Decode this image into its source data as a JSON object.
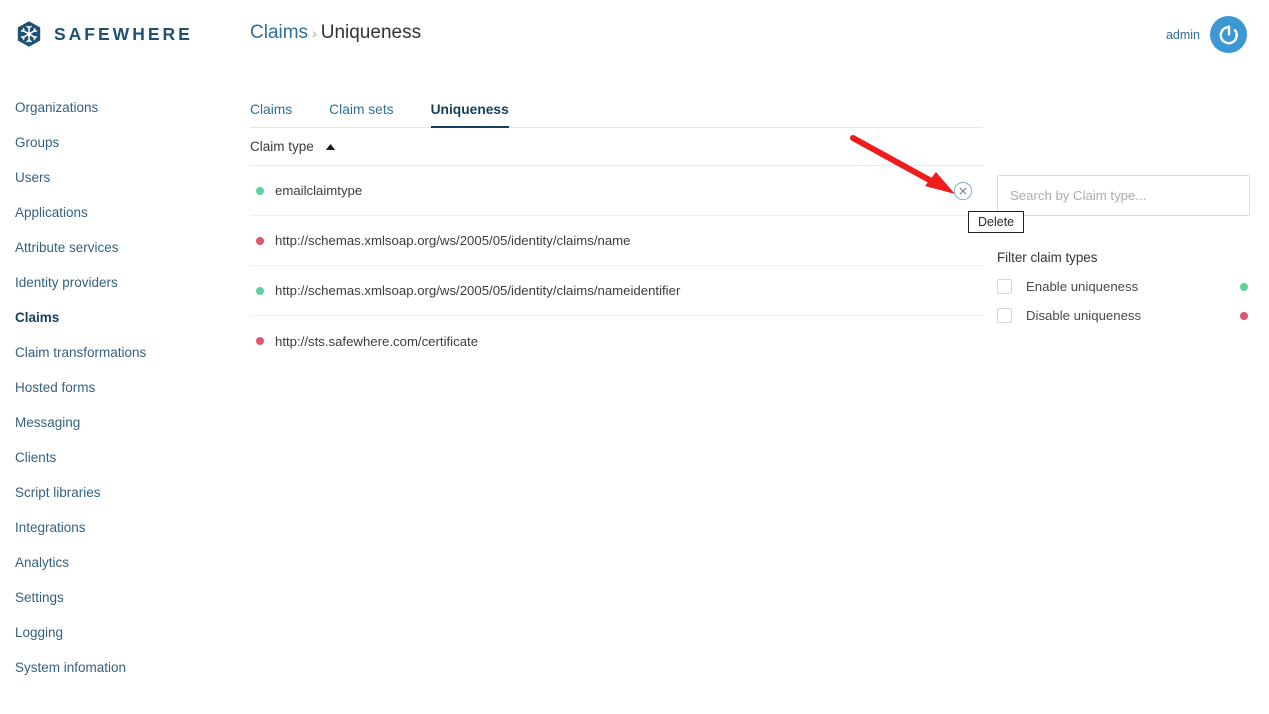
{
  "brand": {
    "name": "SAFEWHERE",
    "logo_icon": "hexagon-snowflake-logo"
  },
  "header": {
    "breadcrumb": {
      "parent": "Claims",
      "separator": "›",
      "current": "Uniqueness"
    },
    "user": {
      "name": "admin",
      "avatar_icon": "power-avatar-icon"
    }
  },
  "sidebar": {
    "items": [
      {
        "label": "Organizations",
        "active": false
      },
      {
        "label": "Groups",
        "active": false
      },
      {
        "label": "Users",
        "active": false
      },
      {
        "label": "Applications",
        "active": false
      },
      {
        "label": "Attribute services",
        "active": false
      },
      {
        "label": "Identity providers",
        "active": false
      },
      {
        "label": "Claims",
        "active": true
      },
      {
        "label": "Claim transformations",
        "active": false
      },
      {
        "label": "Hosted forms",
        "active": false
      },
      {
        "label": "Messaging",
        "active": false
      },
      {
        "label": "Clients",
        "active": false
      },
      {
        "label": "Script libraries",
        "active": false
      },
      {
        "label": "Integrations",
        "active": false
      },
      {
        "label": "Analytics",
        "active": false
      },
      {
        "label": "Settings",
        "active": false
      },
      {
        "label": "Logging",
        "active": false
      },
      {
        "label": "System infomation",
        "active": false
      }
    ]
  },
  "main": {
    "tabs": [
      {
        "label": "Claims",
        "active": false
      },
      {
        "label": "Claim sets",
        "active": false
      },
      {
        "label": "Uniqueness",
        "active": true
      }
    ],
    "table": {
      "column_header": "Claim type",
      "sort_direction": "ascending",
      "sort_icon": "caret-up-icon",
      "rows": [
        {
          "status": "green",
          "label": "emailclaimtype",
          "delete_icon": "circle-x-delete-icon",
          "delete_visible": true
        },
        {
          "status": "red",
          "label": "http://schemas.xmlsoap.org/ws/2005/05/identity/claims/name",
          "delete_icon": "circle-x-delete-icon",
          "delete_visible": false
        },
        {
          "status": "green",
          "label": "http://schemas.xmlsoap.org/ws/2005/05/identity/claims/nameidentifier",
          "delete_icon": "circle-x-delete-icon",
          "delete_visible": false
        },
        {
          "status": "red",
          "label": "http://sts.safewhere.com/certificate",
          "delete_icon": "circle-x-delete-icon",
          "delete_visible": false
        }
      ]
    }
  },
  "rail": {
    "search": {
      "value": "",
      "placeholder": "Search by Claim type..."
    },
    "filter_title": "Filter claim types",
    "filters": [
      {
        "label": "Enable uniqueness",
        "checked": false,
        "dot_color": "#5ed39b"
      },
      {
        "label": "Disable uniqueness",
        "checked": false,
        "dot_color": "#e0566b"
      }
    ]
  },
  "tooltip": {
    "text": "Delete"
  },
  "annotation": {
    "arrow_color": "#ee1c1c",
    "arrow_icon": "red-pointer-arrow"
  },
  "colors": {
    "brand_blue": "#1d5275",
    "link_blue": "#2f6f96",
    "active_navy": "#15405c",
    "status_green": "#5ed39b",
    "status_red": "#e0566b",
    "avatar_blue": "#3d97d3",
    "annotation_red": "#ee1c1c"
  }
}
